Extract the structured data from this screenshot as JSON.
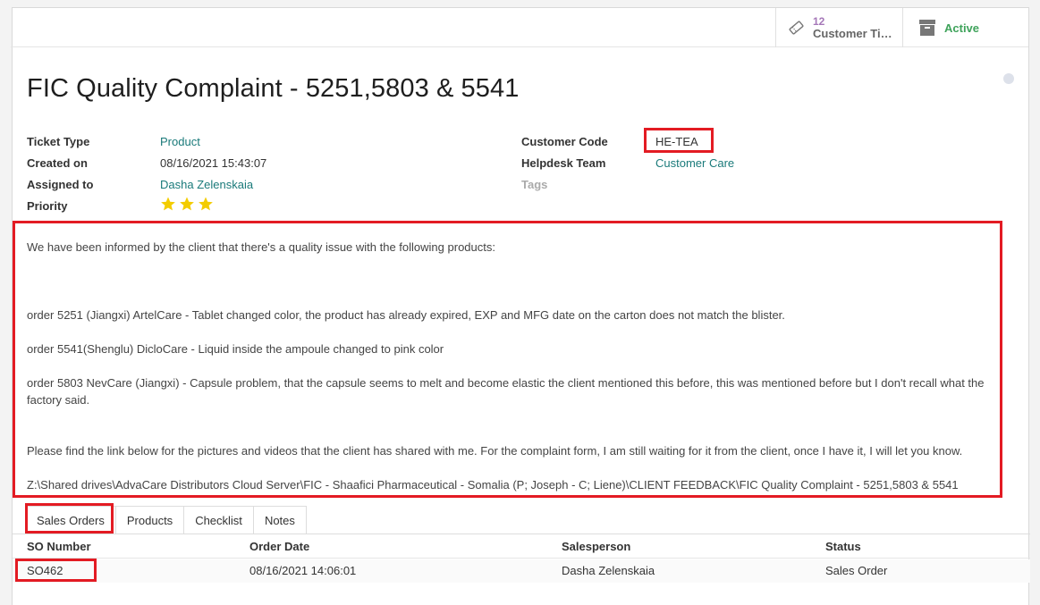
{
  "button_box": {
    "tickets_count": "12",
    "tickets_label": "Customer Tic...",
    "active_label": "Active"
  },
  "title": "FIC Quality Complaint - 5251,5803 & 5541",
  "fields": {
    "ticket_type_label": "Ticket Type",
    "ticket_type_value": "Product",
    "created_on_label": "Created on",
    "created_on_value": "08/16/2021 15:43:07",
    "assigned_to_label": "Assigned to",
    "assigned_to_value": "Dasha Zelenskaia",
    "priority_label": "Priority",
    "priority_stars": 3,
    "customer_code_label": "Customer Code",
    "customer_code_value": "HE-TEA",
    "helpdesk_team_label": "Helpdesk Team",
    "helpdesk_team_value": "Customer Care",
    "tags_label": "Tags"
  },
  "description": [
    "We have been informed by the client that there's a quality issue with the following products:",
    "order 5251 (Jiangxi) ArtelCare - Tablet changed color, the product has already expired, EXP and MFG date on the carton does not match the blister.",
    "order 5541(Shenglu) DicloCare - Liquid inside the ampoule changed to pink color",
    "order 5803 NevCare (Jiangxi) - Capsule problem, that the capsule seems to melt and become elastic the client mentioned this before, this was mentioned before but I don't recall what the",
    "factory said.",
    "Please find the link below for the pictures and videos that the client has shared with me. For the complaint form, I am still waiting for it from the client, once I have it, I will let you know.",
    "Z:\\Shared drives\\AdvaCare Distributors Cloud Server\\FIC - Shaafici Pharmaceutical - Somalia (P; Joseph - C; Liene)\\CLIENT FEEDBACK\\FIC Quality Complaint - 5251,5803 & 5541"
  ],
  "tabs": [
    "Sales Orders",
    "Products",
    "Checklist",
    "Notes"
  ],
  "table": {
    "headers": [
      "SO Number",
      "Order Date",
      "Salesperson",
      "Status"
    ],
    "rows": [
      [
        "SO462",
        "08/16/2021 14:06:01",
        "Dasha Zelenskaia",
        "Sales Order"
      ]
    ]
  },
  "colors": {
    "highlight": "#e31b23",
    "link": "#1a7a7a",
    "star": "#f3cc00"
  },
  "icons": {
    "tickets": "ticket-icon",
    "active": "archive-icon"
  }
}
